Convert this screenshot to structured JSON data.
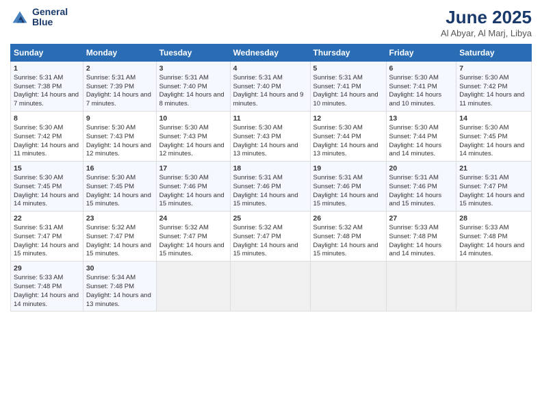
{
  "header": {
    "logo_line1": "General",
    "logo_line2": "Blue",
    "title": "June 2025",
    "subtitle": "Al Abyar, Al Marj, Libya"
  },
  "columns": [
    "Sunday",
    "Monday",
    "Tuesday",
    "Wednesday",
    "Thursday",
    "Friday",
    "Saturday"
  ],
  "rows": [
    [
      {
        "day": "1",
        "sunrise": "5:31 AM",
        "sunset": "7:38 PM",
        "daylight": "14 hours and 7 minutes."
      },
      {
        "day": "2",
        "sunrise": "5:31 AM",
        "sunset": "7:39 PM",
        "daylight": "14 hours and 7 minutes."
      },
      {
        "day": "3",
        "sunrise": "5:31 AM",
        "sunset": "7:40 PM",
        "daylight": "14 hours and 8 minutes."
      },
      {
        "day": "4",
        "sunrise": "5:31 AM",
        "sunset": "7:40 PM",
        "daylight": "14 hours and 9 minutes."
      },
      {
        "day": "5",
        "sunrise": "5:31 AM",
        "sunset": "7:41 PM",
        "daylight": "14 hours and 10 minutes."
      },
      {
        "day": "6",
        "sunrise": "5:30 AM",
        "sunset": "7:41 PM",
        "daylight": "14 hours and 10 minutes."
      },
      {
        "day": "7",
        "sunrise": "5:30 AM",
        "sunset": "7:42 PM",
        "daylight": "14 hours and 11 minutes."
      }
    ],
    [
      {
        "day": "8",
        "sunrise": "5:30 AM",
        "sunset": "7:42 PM",
        "daylight": "14 hours and 11 minutes."
      },
      {
        "day": "9",
        "sunrise": "5:30 AM",
        "sunset": "7:43 PM",
        "daylight": "14 hours and 12 minutes."
      },
      {
        "day": "10",
        "sunrise": "5:30 AM",
        "sunset": "7:43 PM",
        "daylight": "14 hours and 12 minutes."
      },
      {
        "day": "11",
        "sunrise": "5:30 AM",
        "sunset": "7:43 PM",
        "daylight": "14 hours and 13 minutes."
      },
      {
        "day": "12",
        "sunrise": "5:30 AM",
        "sunset": "7:44 PM",
        "daylight": "14 hours and 13 minutes."
      },
      {
        "day": "13",
        "sunrise": "5:30 AM",
        "sunset": "7:44 PM",
        "daylight": "14 hours and 14 minutes."
      },
      {
        "day": "14",
        "sunrise": "5:30 AM",
        "sunset": "7:45 PM",
        "daylight": "14 hours and 14 minutes."
      }
    ],
    [
      {
        "day": "15",
        "sunrise": "5:30 AM",
        "sunset": "7:45 PM",
        "daylight": "14 hours and 14 minutes."
      },
      {
        "day": "16",
        "sunrise": "5:30 AM",
        "sunset": "7:45 PM",
        "daylight": "14 hours and 15 minutes."
      },
      {
        "day": "17",
        "sunrise": "5:30 AM",
        "sunset": "7:46 PM",
        "daylight": "14 hours and 15 minutes."
      },
      {
        "day": "18",
        "sunrise": "5:31 AM",
        "sunset": "7:46 PM",
        "daylight": "14 hours and 15 minutes."
      },
      {
        "day": "19",
        "sunrise": "5:31 AM",
        "sunset": "7:46 PM",
        "daylight": "14 hours and 15 minutes."
      },
      {
        "day": "20",
        "sunrise": "5:31 AM",
        "sunset": "7:46 PM",
        "daylight": "14 hours and 15 minutes."
      },
      {
        "day": "21",
        "sunrise": "5:31 AM",
        "sunset": "7:47 PM",
        "daylight": "14 hours and 15 minutes."
      }
    ],
    [
      {
        "day": "22",
        "sunrise": "5:31 AM",
        "sunset": "7:47 PM",
        "daylight": "14 hours and 15 minutes."
      },
      {
        "day": "23",
        "sunrise": "5:32 AM",
        "sunset": "7:47 PM",
        "daylight": "14 hours and 15 minutes."
      },
      {
        "day": "24",
        "sunrise": "5:32 AM",
        "sunset": "7:47 PM",
        "daylight": "14 hours and 15 minutes."
      },
      {
        "day": "25",
        "sunrise": "5:32 AM",
        "sunset": "7:47 PM",
        "daylight": "14 hours and 15 minutes."
      },
      {
        "day": "26",
        "sunrise": "5:32 AM",
        "sunset": "7:48 PM",
        "daylight": "14 hours and 15 minutes."
      },
      {
        "day": "27",
        "sunrise": "5:33 AM",
        "sunset": "7:48 PM",
        "daylight": "14 hours and 14 minutes."
      },
      {
        "day": "28",
        "sunrise": "5:33 AM",
        "sunset": "7:48 PM",
        "daylight": "14 hours and 14 minutes."
      }
    ],
    [
      {
        "day": "29",
        "sunrise": "5:33 AM",
        "sunset": "7:48 PM",
        "daylight": "14 hours and 14 minutes."
      },
      {
        "day": "30",
        "sunrise": "5:34 AM",
        "sunset": "7:48 PM",
        "daylight": "14 hours and 13 minutes."
      },
      null,
      null,
      null,
      null,
      null
    ]
  ]
}
